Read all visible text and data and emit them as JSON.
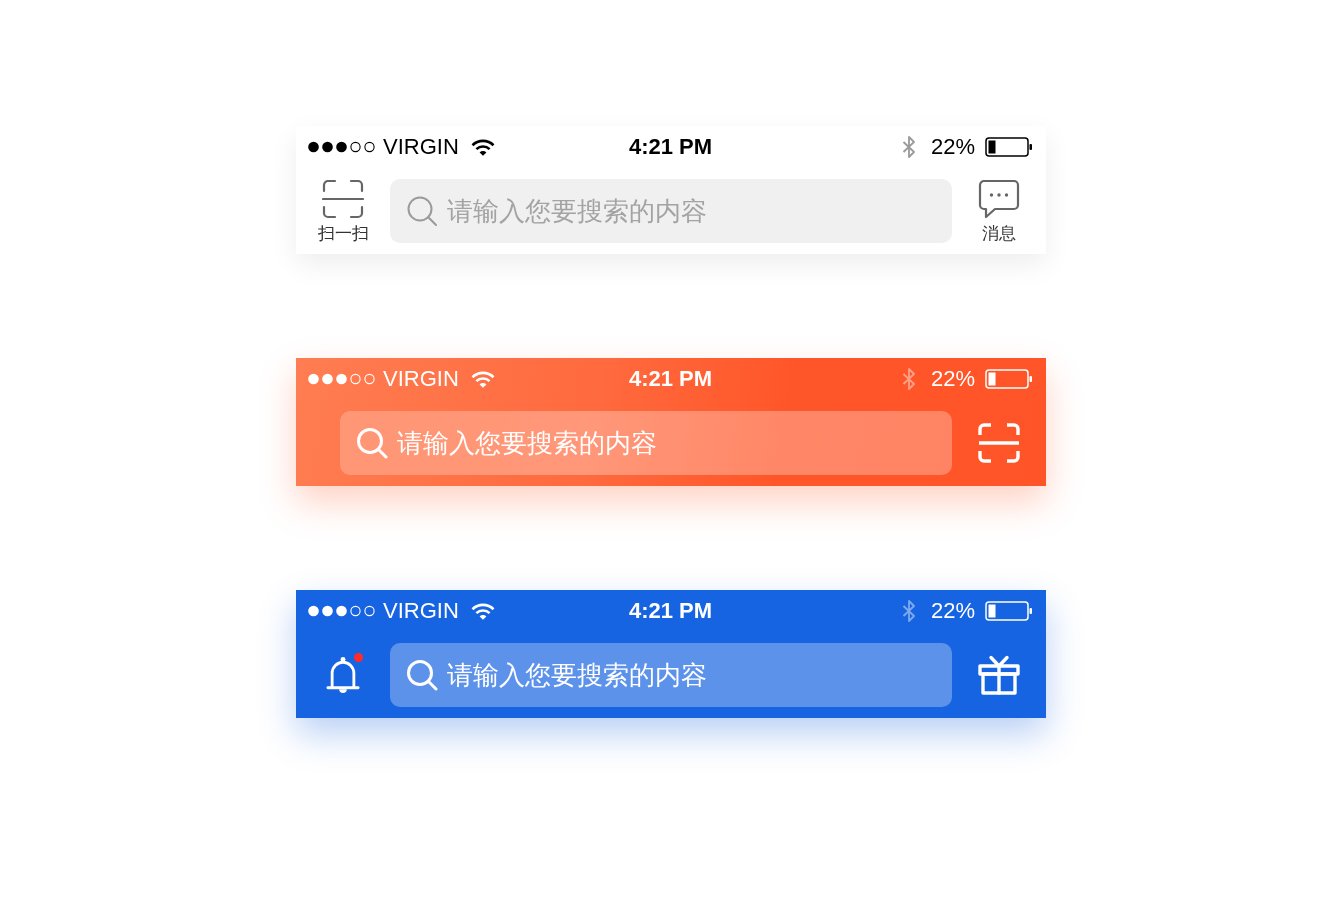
{
  "bars": [
    {
      "kind": "light",
      "status_bar": {
        "carrier": "VIRGIN",
        "time": "4:21 PM",
        "battery": "22%"
      },
      "leading": {
        "kind": "scan",
        "label": "扫一扫"
      },
      "search": {
        "placeholder": "请输入您要搜索的内容"
      },
      "trailing": {
        "kind": "message",
        "label": "消息"
      }
    },
    {
      "kind": "orange",
      "status_bar": {
        "carrier": "VIRGIN",
        "time": "4:21 PM",
        "battery": "22%"
      },
      "search": {
        "placeholder": "请输入您要搜索的内容"
      },
      "trailing": {
        "kind": "scan"
      }
    },
    {
      "kind": "blue",
      "status_bar": {
        "carrier": "VIRGIN",
        "time": "4:21 PM",
        "battery": "22%"
      },
      "leading": {
        "kind": "bell",
        "badge": true
      },
      "search": {
        "placeholder": "请输入您要搜索的内容"
      },
      "trailing": {
        "kind": "gift"
      }
    }
  ]
}
